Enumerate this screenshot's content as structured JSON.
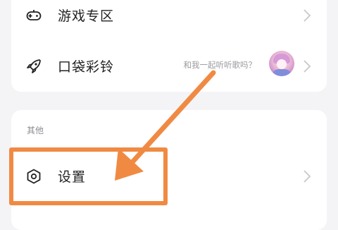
{
  "menu_top": {
    "items": [
      {
        "label": "游戏专区",
        "icon": "game-controller-icon"
      },
      {
        "label": "口袋彩铃",
        "icon": "rocket-icon",
        "hint": "和我一起听听歌吗？"
      }
    ]
  },
  "other_section": {
    "title": "其他",
    "items": [
      {
        "label": "设置",
        "icon": "settings-icon"
      }
    ]
  },
  "colors": {
    "highlight": "#f08a43",
    "background": "#f4f4f6",
    "card": "#ffffff"
  }
}
